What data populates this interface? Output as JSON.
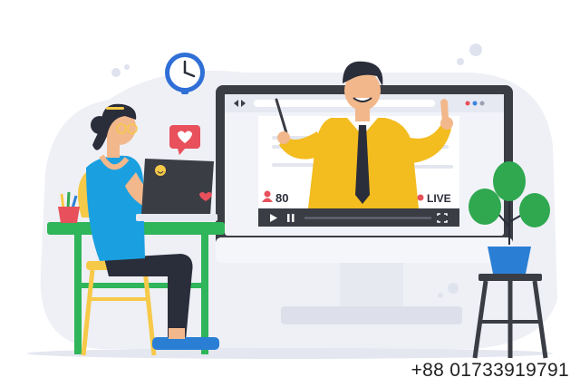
{
  "video": {
    "viewer_count": "80",
    "live_label": "LIVE"
  },
  "contact": {
    "phone": "+88 01733919791"
  },
  "colors": {
    "background_blob": "#eef0f6",
    "monitor_frame": "#3b3d45",
    "screen_bg": "#f1f3f8",
    "teacher_shirt": "#f3bc1f",
    "student_top": "#1aa0e0",
    "desk_green": "#2fb55a",
    "chair_yellow": "#f7c948",
    "live_red": "#e8505b",
    "plant_green": "#2fa84f",
    "pot_blue": "#2a7fd4"
  },
  "icons": [
    "clock-icon",
    "heart-bubble-icon",
    "user-icon",
    "play-icon",
    "pause-icon",
    "fullscreen-icon",
    "live-dot-icon"
  ]
}
